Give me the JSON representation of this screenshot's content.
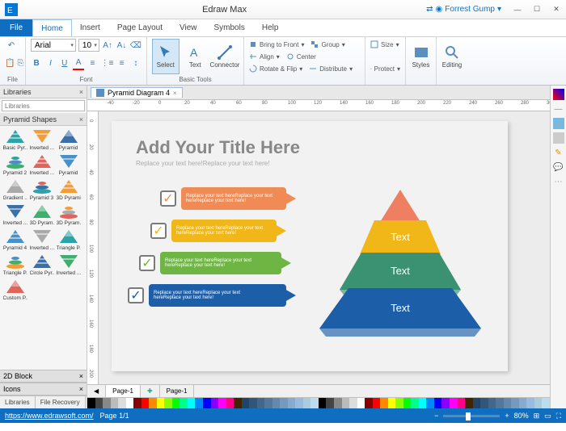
{
  "app": {
    "name": "Edraw Max",
    "user": "Forrest Gump"
  },
  "menu": {
    "file": "File",
    "tabs": [
      "Home",
      "Insert",
      "Page Layout",
      "View",
      "Symbols",
      "Help"
    ],
    "active": 0
  },
  "ribbon": {
    "file_label": "File",
    "font": {
      "family": "Arial",
      "size": "10",
      "label": "Font"
    },
    "tools": {
      "select": "Select",
      "text": "Text",
      "connector": "Connector",
      "label": "Basic Tools"
    },
    "ops": {
      "bring_front": "Bring to Front",
      "group": "Group",
      "size": "Size",
      "align": "Align",
      "center": "Center",
      "rotate": "Rotate & Flip",
      "distribute": "Distribute",
      "protect": "Protect"
    },
    "styles": "Styles",
    "editing": "Editing"
  },
  "libraries": {
    "title": "Libraries",
    "section": "Pyramid Shapes",
    "shapes": [
      "Basic Pyr...",
      "Inverted ...",
      "Pyramid",
      "Pyramid 2",
      "Inverted ...",
      "Pyramid",
      "Gradient ...",
      "Pyramid 3",
      "3D Pyramid",
      "Inverted ...",
      "3D Pyram...",
      "3D Pyram...",
      "Pyramid 4",
      "Inverted ...",
      "Triangle P...",
      "Triangle P...",
      "Circle Pyr...",
      "Inverted ...",
      "Custom P..."
    ],
    "sections": [
      "2D Block",
      "Icons"
    ],
    "tabs": [
      "Libraries",
      "File Recovery"
    ]
  },
  "doc": {
    "tab": "Pyramid Diagram 4"
  },
  "page": {
    "title": "Add Your Title Here",
    "subtitle": "Replace your text here!Replace your text here!",
    "callout": "Replace your text hereReplace your text\nhereReplace your text here!",
    "pyr_text": "Text"
  },
  "page_tabs": {
    "p1": "Page-1",
    "p2": "Page-1"
  },
  "status": {
    "url": "https://www.edrawsoft.com/",
    "page": "Page 1/1",
    "zoom": "80%"
  },
  "colors": {
    "callouts": [
      "#f08b56",
      "#f1b617",
      "#6fb544",
      "#1d5ea8"
    ],
    "checks": [
      "#f08b56",
      "#f1b617",
      "#6fb544",
      "#1d5ea8"
    ],
    "layers": [
      "#ef7f61",
      "#f1b617",
      "#3b9272",
      "#1d5ea8"
    ]
  }
}
